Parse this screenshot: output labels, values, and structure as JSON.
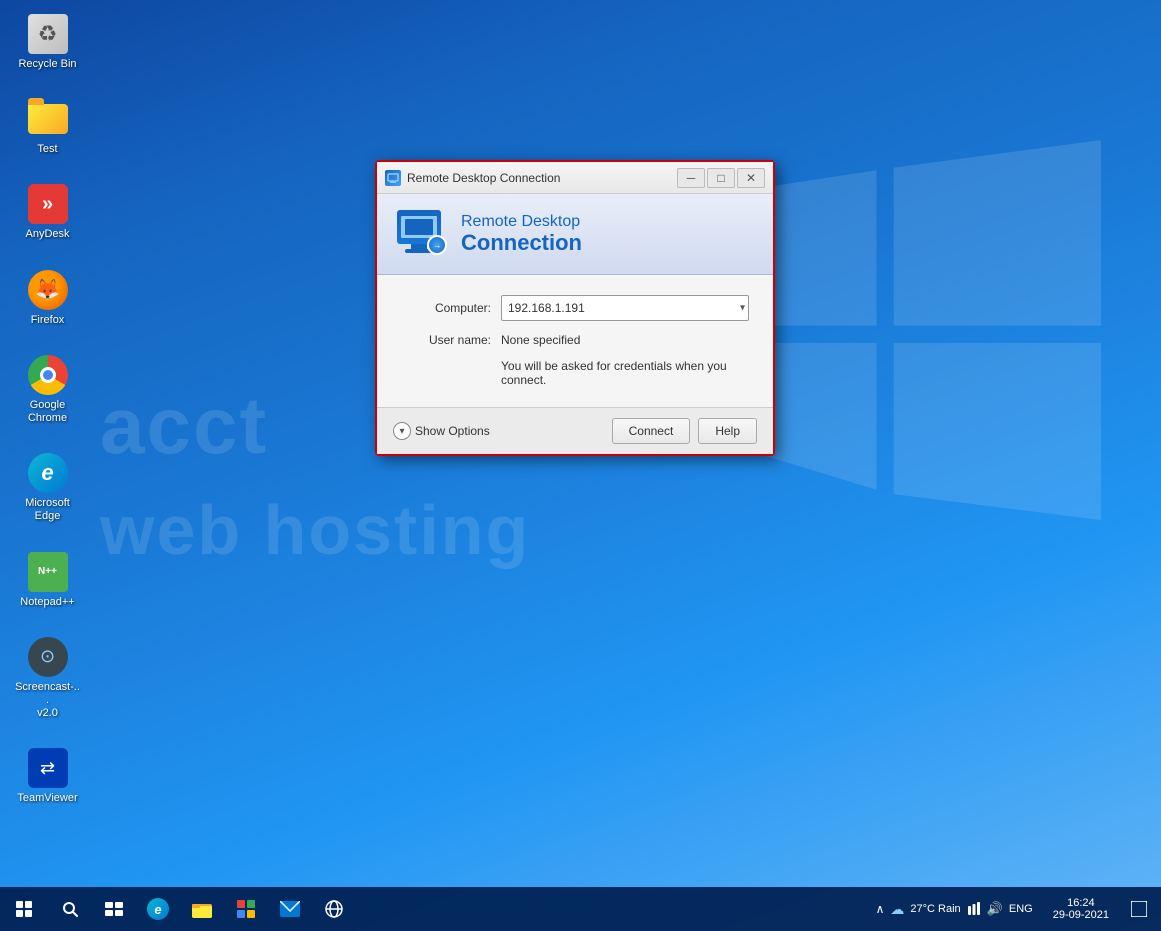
{
  "desktop": {
    "icons": [
      {
        "id": "recycle-bin",
        "label": "Recycle Bin",
        "type": "recycle"
      },
      {
        "id": "test-folder",
        "label": "Test",
        "type": "folder"
      },
      {
        "id": "anydesk",
        "label": "AnyDesk",
        "type": "anydesk"
      },
      {
        "id": "firefox",
        "label": "Firefox",
        "type": "firefox"
      },
      {
        "id": "google-chrome",
        "label": "Google Chrome",
        "type": "chrome"
      },
      {
        "id": "microsoft-edge",
        "label": "Microsoft Edge",
        "type": "edge"
      },
      {
        "id": "notepadpp",
        "label": "Notepad++",
        "type": "notepadpp"
      },
      {
        "id": "screencast",
        "label": "Screencast-...\nv2.0",
        "type": "screencast"
      },
      {
        "id": "teamviewer",
        "label": "TeamViewer",
        "type": "teamviewer"
      }
    ]
  },
  "dialog": {
    "title": "Remote Desktop Connection",
    "header_line1": "Remote Desktop",
    "header_line2": "Connection",
    "computer_label": "Computer:",
    "computer_value": "192.168.1.191",
    "username_label": "User name:",
    "username_value": "None specified",
    "credentials_note": "You will be asked for credentials when you connect.",
    "show_options_label": "Show Options",
    "connect_btn": "Connect",
    "help_btn": "Help"
  },
  "taskbar": {
    "weather": "27°C Rain",
    "language": "ENG",
    "time": "16:24",
    "date": "29-09-2021"
  },
  "watermark": {
    "line1": "acct",
    "line2": "web hosting"
  }
}
